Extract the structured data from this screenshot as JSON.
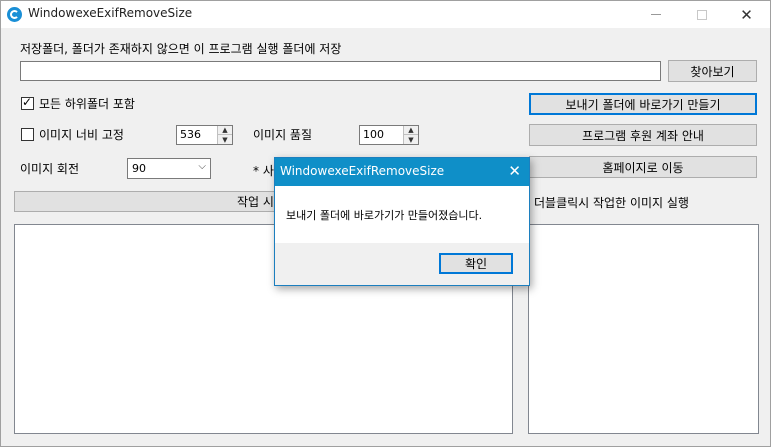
{
  "window": {
    "title": "WindowexeExifRemoveSize",
    "close_glyph": "✕"
  },
  "form": {
    "save_folder_label": "저장폴더, 폴더가 존재하지 않으면 이 프로그램 실행 폴더에 저장",
    "save_folder_value": "",
    "browse_button": "찾아보기",
    "include_subfolders_label": "모든 하위폴더 포함",
    "include_subfolders_checked": true,
    "fix_width_label": "이미지 너비 고정",
    "fix_width_checked": false,
    "width_value": "536",
    "quality_label": "이미지 품질",
    "quality_value": "100",
    "rotate_label": "이미지 회전",
    "rotate_value": "90",
    "note_prefix": "* 사",
    "start_button_prefix": "작업 시",
    "double_click_hint": "더블클릭시 작업한 이미지 실행",
    "shortcut_button": "보내기 폴더에 바로가기 만들기",
    "donation_button": "프로그램 후원 계좌 안내",
    "homepage_button": "홈페이지로 이동"
  },
  "dialog": {
    "title": "WindowexeExifRemoveSize",
    "message": "보내기 폴더에 바로가기가 만들어졌습니다.",
    "ok_button": "확인",
    "close_glyph": "✕"
  },
  "colors": {
    "dialog_title_bg": "#0f8fc8",
    "focus_border": "#0078d7",
    "window_bg": "#f0f0f0"
  }
}
